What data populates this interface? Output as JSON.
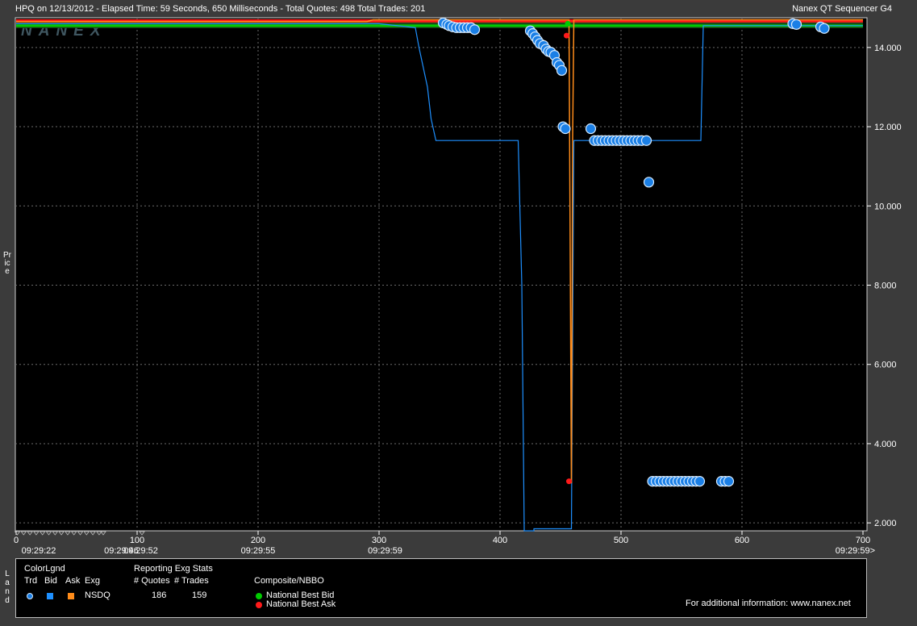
{
  "header": {
    "title_left": "HPQ on 12/13/2012  -  Elapsed Time: 59 Seconds, 650 Milliseconds  -  Total Quotes: 498  Total Trades: 201",
    "title_right": "Nanex QT Sequencer G4",
    "watermark": "NANEX"
  },
  "y_axis_label": "Price",
  "x_time_labels": [
    {
      "x": 0,
      "time": "09:29:22"
    },
    {
      "x": 87,
      "time": "09:29:46"
    },
    {
      "x": 103,
      "time": "09:29:52"
    },
    {
      "x": 200,
      "time": "09:29:55"
    },
    {
      "x": 305,
      "time": "09:29:59"
    },
    {
      "x": 700,
      "time": "09:29:59>"
    }
  ],
  "colors": {
    "trade": "#1a7fe6",
    "bid_line": "#1e90ff",
    "ask_line": "#ff8c1a",
    "nbbo_bid": "#00cc00",
    "nbbo_ask": "#ff1a1a"
  },
  "chart_data": {
    "type": "scatter",
    "title": "HPQ on 12/13/2012",
    "ylabel": "Price",
    "xlim": [
      0,
      700
    ],
    "ylim": [
      1.8,
      14.75
    ],
    "x_ticks": [
      0,
      100,
      200,
      300,
      400,
      500,
      600,
      700
    ],
    "y_ticks": [
      "2.000",
      "4.000",
      "6.000",
      "8.000",
      "10.000",
      "12.000",
      "14.000"
    ],
    "grid": true,
    "series": [
      {
        "name": "NSDQ Bid",
        "kind": "step",
        "points": [
          [
            0,
            14.6
          ],
          [
            300,
            14.6
          ],
          [
            330,
            14.5
          ],
          [
            333,
            14.0
          ],
          [
            340,
            13.0
          ],
          [
            343,
            12.2
          ],
          [
            347,
            11.65
          ],
          [
            415,
            11.65
          ],
          [
            418,
            8.0
          ],
          [
            420,
            1.8
          ],
          [
            428,
            1.8
          ],
          [
            428,
            1.85
          ],
          [
            459,
            1.85
          ],
          [
            461,
            11.65
          ],
          [
            566,
            11.65
          ],
          [
            568,
            14.55
          ],
          [
            700,
            14.55
          ]
        ]
      },
      {
        "name": "NSDQ Ask",
        "kind": "step",
        "points": [
          [
            0,
            14.65
          ],
          [
            290,
            14.65
          ],
          [
            295,
            14.7
          ],
          [
            457,
            14.7
          ],
          [
            459,
            3.0
          ],
          [
            460,
            11.65
          ],
          [
            461,
            14.7
          ],
          [
            700,
            14.7
          ]
        ]
      },
      {
        "name": "National Best Bid",
        "kind": "band",
        "points": [
          [
            0,
            14.55
          ],
          [
            700,
            14.55
          ]
        ]
      },
      {
        "name": "National Best Ask",
        "kind": "band",
        "points": [
          [
            0,
            14.67
          ],
          [
            700,
            14.67
          ]
        ]
      },
      {
        "name": "Trades",
        "kind": "points",
        "points": [
          [
            353,
            14.62
          ],
          [
            356,
            14.58
          ],
          [
            358,
            14.55
          ],
          [
            361,
            14.52
          ],
          [
            364,
            14.5
          ],
          [
            367,
            14.5
          ],
          [
            370,
            14.5
          ],
          [
            373,
            14.5
          ],
          [
            376,
            14.5
          ],
          [
            379,
            14.45
          ],
          [
            425,
            14.42
          ],
          [
            427,
            14.35
          ],
          [
            429,
            14.27
          ],
          [
            431,
            14.18
          ],
          [
            433,
            14.1
          ],
          [
            436,
            14.05
          ],
          [
            438,
            13.96
          ],
          [
            440,
            13.9
          ],
          [
            442,
            13.88
          ],
          [
            445,
            13.8
          ],
          [
            447,
            13.62
          ],
          [
            449,
            13.55
          ],
          [
            451,
            13.42
          ],
          [
            452,
            12.0
          ],
          [
            454,
            11.95
          ],
          [
            475,
            11.95
          ],
          [
            478,
            11.65
          ],
          [
            481,
            11.65
          ],
          [
            484,
            11.65
          ],
          [
            487,
            11.65
          ],
          [
            490,
            11.65
          ],
          [
            493,
            11.65
          ],
          [
            496,
            11.65
          ],
          [
            499,
            11.65
          ],
          [
            502,
            11.65
          ],
          [
            505,
            11.65
          ],
          [
            508,
            11.65
          ],
          [
            511,
            11.65
          ],
          [
            514,
            11.65
          ],
          [
            517,
            11.65
          ],
          [
            521,
            11.65
          ],
          [
            523,
            10.6
          ],
          [
            526,
            3.05
          ],
          [
            529,
            3.05
          ],
          [
            532,
            3.05
          ],
          [
            535,
            3.05
          ],
          [
            538,
            3.05
          ],
          [
            541,
            3.05
          ],
          [
            544,
            3.05
          ],
          [
            547,
            3.05
          ],
          [
            550,
            3.05
          ],
          [
            553,
            3.05
          ],
          [
            556,
            3.05
          ],
          [
            559,
            3.05
          ],
          [
            562,
            3.05
          ],
          [
            565,
            3.05
          ],
          [
            583,
            3.05
          ],
          [
            586,
            3.05
          ],
          [
            589,
            3.05
          ],
          [
            642,
            14.6
          ],
          [
            645,
            14.58
          ],
          [
            665,
            14.52
          ],
          [
            668,
            14.48
          ]
        ]
      }
    ]
  },
  "legend": {
    "side_label": "Land",
    "color_legend_title": "ColorLgnd",
    "col_trd": "Trd",
    "col_bid": "Bid",
    "col_ask": "Ask",
    "col_exg": "Exg",
    "exchange": "NSDQ",
    "stats_title": "Reporting Exg Stats",
    "col_quotes": "# Quotes",
    "col_trades": "# Trades",
    "quotes": "186",
    "trades": "159",
    "composite_title": "Composite/NBBO",
    "nbbo_bid_label": "National Best Bid",
    "nbbo_ask_label": "National Best Ask",
    "info": "For additional information: www.nanex.net"
  }
}
